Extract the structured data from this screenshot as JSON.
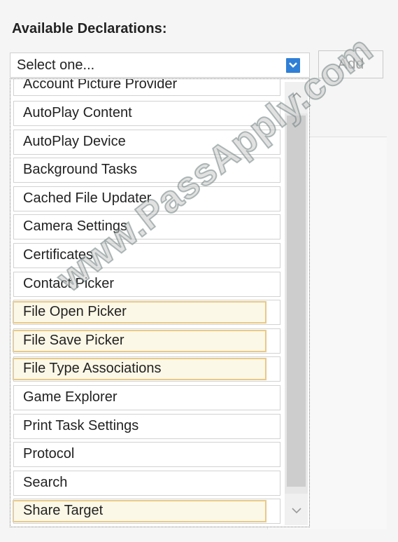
{
  "heading": "Available Declarations:",
  "combo": {
    "value": "Select one...",
    "arrow_color": "#2f7fd6"
  },
  "add_button": {
    "label": "Add"
  },
  "dropdown": {
    "items": [
      {
        "label": "Account Picture Provider",
        "highlighted": false
      },
      {
        "label": "AutoPlay Content",
        "highlighted": false
      },
      {
        "label": "AutoPlay Device",
        "highlighted": false
      },
      {
        "label": "Background Tasks",
        "highlighted": false
      },
      {
        "label": "Cached File Updater",
        "highlighted": false
      },
      {
        "label": "Camera Settings",
        "highlighted": false
      },
      {
        "label": "Certificates",
        "highlighted": false
      },
      {
        "label": "Contact Picker",
        "highlighted": false
      },
      {
        "label": "File Open Picker",
        "highlighted": true
      },
      {
        "label": "File Save Picker",
        "highlighted": true
      },
      {
        "label": "File Type Associations",
        "highlighted": true
      },
      {
        "label": "Game Explorer",
        "highlighted": false
      },
      {
        "label": "Print Task Settings",
        "highlighted": false
      },
      {
        "label": "Protocol",
        "highlighted": false
      },
      {
        "label": "Search",
        "highlighted": false
      },
      {
        "label": "Share Target",
        "highlighted": true
      }
    ],
    "scroll_up_icon": "chevron-up-icon",
    "scroll_down_icon": "chevron-down-icon"
  },
  "watermark": "www.PassApply.com",
  "highlight_color": "#e8c988"
}
